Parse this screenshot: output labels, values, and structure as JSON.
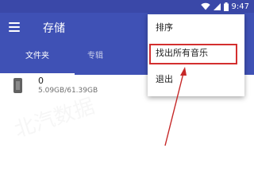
{
  "status_bar": {
    "time": "9:47",
    "icons": [
      "wifi-icon",
      "signal-icon",
      "battery-icon"
    ]
  },
  "toolbar": {
    "title": "存储",
    "tabs": [
      {
        "label": "文件夹",
        "selected": true
      },
      {
        "label": "专辑",
        "selected": false
      }
    ]
  },
  "storage_list": [
    {
      "name": "0",
      "size": "5.09GB/61.39GB",
      "icon": "phone-icon"
    }
  ],
  "overflow_menu": {
    "items": [
      {
        "label": "排序"
      },
      {
        "label": "找出所有音乐",
        "highlighted": true
      },
      {
        "label": "退出"
      }
    ]
  },
  "watermark": "北汽数据",
  "colors": {
    "primary": "#3f51b5",
    "status_bar": "#3a48a8",
    "highlight": "#d32f2f"
  }
}
